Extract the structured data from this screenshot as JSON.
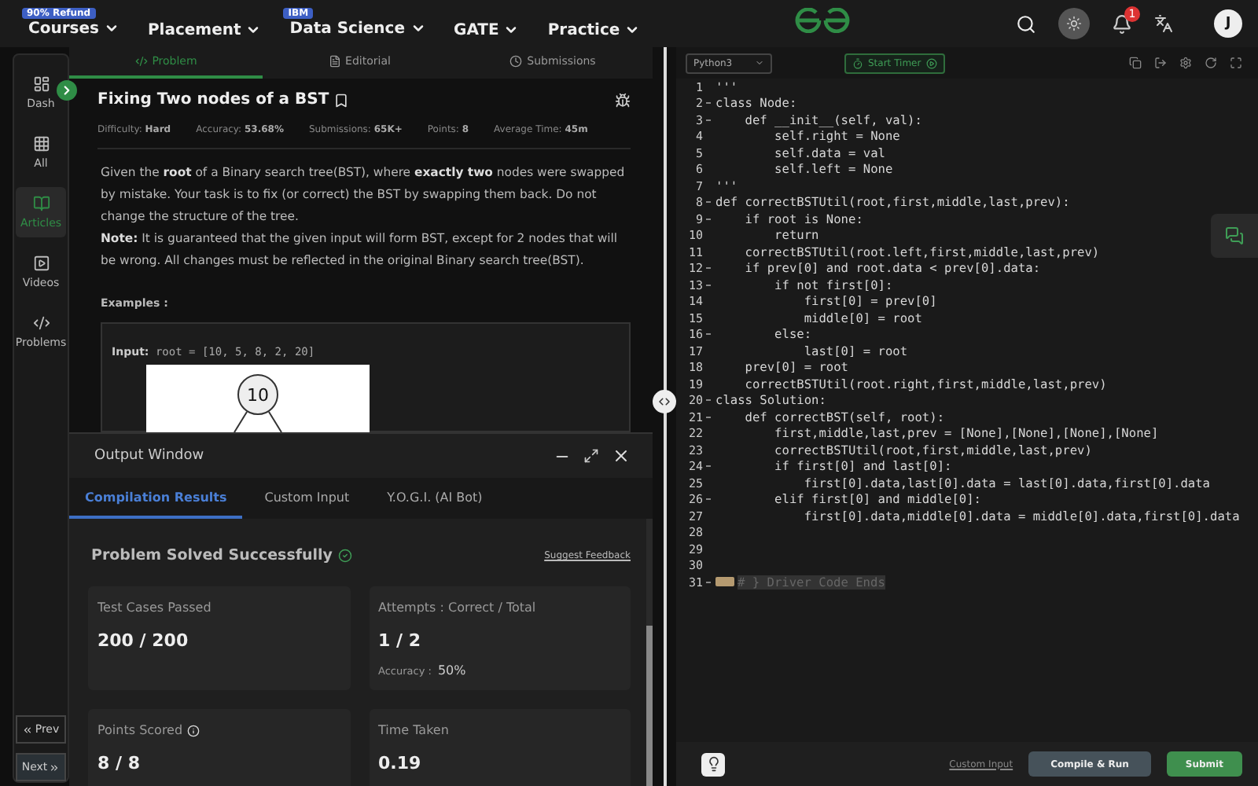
{
  "nav": {
    "items": [
      {
        "label": "Courses",
        "badge": "90% Refund"
      },
      {
        "label": "Placement"
      },
      {
        "label": "Data Science",
        "badge": "IBM"
      },
      {
        "label": "GATE"
      },
      {
        "label": "Practice"
      }
    ],
    "notifications": "1",
    "avatar": "J"
  },
  "sidebar": {
    "items": [
      {
        "label": "Dash",
        "selected": false
      },
      {
        "label": "All",
        "selected": false
      },
      {
        "label": "Articles",
        "selected": true
      },
      {
        "label": "Videos",
        "selected": false
      },
      {
        "label": "Problems",
        "selected": false
      }
    ],
    "prev": "Prev",
    "next": "Next"
  },
  "problem_tabs": [
    {
      "label": "Problem",
      "selected": true
    },
    {
      "label": "Editorial",
      "selected": false
    },
    {
      "label": "Submissions",
      "selected": false
    }
  ],
  "problem": {
    "title": "Fixing Two nodes of a BST",
    "meta": [
      "Difficulty: **Hard**",
      "Accuracy: **53.68%**",
      "Submissions: **65K+**",
      "Points: **8**",
      "Average Time: **45m**"
    ],
    "description": "Given the **root** of a Binary search tree(BST), where **exactly two** nodes were swapped by mistake. Your task is to fix (or correct) the BST by swapping them back. Do not change the structure of the tree.",
    "note": "**Note:** It is guaranteed that the given input will form BST, except for 2 nodes that will be wrong. All changes must be reflected in the original Binary search tree(BST).",
    "examples_heading": "Examples :",
    "example_input_label": "Input:",
    "example_input": "root = [10, 5, 8, 2, 20]",
    "diagram_node": "10"
  },
  "output_window": {
    "title": "Output Window",
    "tabs": [
      {
        "label": "Compilation Results",
        "selected": true
      },
      {
        "label": "Custom Input",
        "selected": false
      },
      {
        "label": "Y.O.G.I. (AI Bot)",
        "selected": false
      }
    ],
    "status": "Problem Solved Successfully",
    "feedback_link": "Suggest Feedback",
    "cards": [
      {
        "label": "Test Cases Passed",
        "value": "200 / 200"
      },
      {
        "label": "Attempts : Correct / Total",
        "value": "1 / 2",
        "sub_label": "Accuracy :",
        "sub_value": "50%"
      },
      {
        "label": "Points Scored",
        "value": "8 / 8",
        "info": true
      },
      {
        "label": "Time Taken",
        "value": "0.19"
      }
    ]
  },
  "editor": {
    "language": "Python3",
    "timer_button": "Start Timer",
    "lines": [
      {
        "n": "1",
        "text": "'''",
        "fold": false
      },
      {
        "n": "2",
        "text": "class Node:",
        "fold": true
      },
      {
        "n": "3",
        "text": "    def __init__(self, val):",
        "fold": true
      },
      {
        "n": "4",
        "text": "        self.right = None",
        "fold": false
      },
      {
        "n": "5",
        "text": "        self.data = val",
        "fold": false
      },
      {
        "n": "6",
        "text": "        self.left = None",
        "fold": false
      },
      {
        "n": "7",
        "text": "'''",
        "fold": false
      },
      {
        "n": "8",
        "text": "def correctBSTUtil(root,first,middle,last,prev):",
        "fold": true
      },
      {
        "n": "9",
        "text": "    if root is None:",
        "fold": true
      },
      {
        "n": "10",
        "text": "        return",
        "fold": false
      },
      {
        "n": "11",
        "text": "    correctBSTUtil(root.left,first,middle,last,prev)",
        "fold": false
      },
      {
        "n": "12",
        "text": "    if prev[0] and root.data < prev[0].data:",
        "fold": true
      },
      {
        "n": "13",
        "text": "        if not first[0]:",
        "fold": true
      },
      {
        "n": "14",
        "text": "            first[0] = prev[0]",
        "fold": false
      },
      {
        "n": "15",
        "text": "            middle[0] = root",
        "fold": false
      },
      {
        "n": "16",
        "text": "        else:",
        "fold": true
      },
      {
        "n": "17",
        "text": "            last[0] = root",
        "fold": false
      },
      {
        "n": "18",
        "text": "    prev[0] = root",
        "fold": false
      },
      {
        "n": "19",
        "text": "    correctBSTUtil(root.right,first,middle,last,prev)",
        "fold": false
      },
      {
        "n": "20",
        "text": "class Solution:",
        "fold": true
      },
      {
        "n": "21",
        "text": "    def correctBST(self, root):",
        "fold": true
      },
      {
        "n": "22",
        "text": "        first,middle,last,prev = [None],[None],[None],[None]",
        "fold": false
      },
      {
        "n": "23",
        "text": "        correctBSTUtil(root,first,middle,last,prev)",
        "fold": false
      },
      {
        "n": "24",
        "text": "        if first[0] and last[0]:",
        "fold": true
      },
      {
        "n": "25",
        "text": "            first[0].data,last[0].data = last[0].data,first[0].data",
        "fold": false
      },
      {
        "n": "26",
        "text": "        elif first[0] and middle[0]:",
        "fold": true
      },
      {
        "n": "27",
        "text": "            first[0].data,middle[0].data = middle[0].data,first[0].data",
        "fold": false
      },
      {
        "n": "28",
        "fold": false
      },
      {
        "n": "29",
        "fold": false
      },
      {
        "n": "30",
        "fold": false
      },
      {
        "n": "31",
        "text": "# } Driver Code Ends",
        "fold": true,
        "collapsed": true
      }
    ],
    "custom_input": "Custom Input",
    "compile_button": "Compile & Run",
    "submit_button": "Submit"
  }
}
